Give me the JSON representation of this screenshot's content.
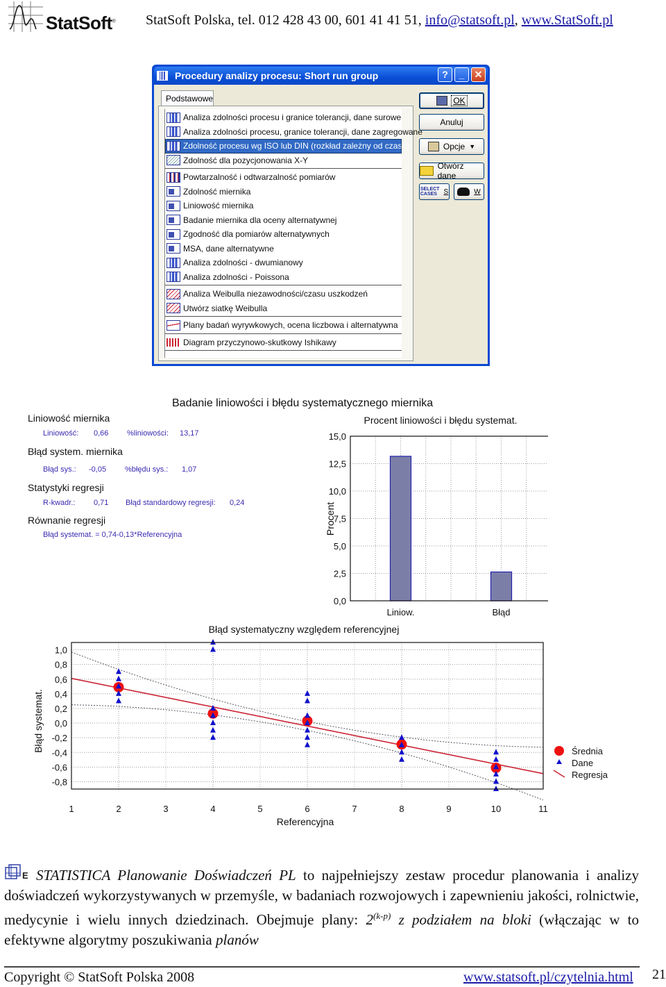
{
  "header": {
    "brand": "StatSoft",
    "contact_prefix": "StatSoft Polska, tel. 012 428 43 00, 601 41 41 51, ",
    "email": "info@statsoft.pl",
    "separator": ", ",
    "website": "www.StatSoft.pl"
  },
  "dialog": {
    "title": "Procedury analizy procesu: Short run group",
    "title_buttons": {
      "help": "?",
      "minimize": "_",
      "close": "✕"
    },
    "tab": "Podstawowe",
    "list_groups": [
      [
        {
          "label": "Analiza zdolności procesu i granice tolerancji, dane surowe",
          "icon": "capability-icon"
        },
        {
          "label": "Analiza zdolności procesu, granice tolerancji, dane zagregowane",
          "icon": "capability-icon"
        },
        {
          "label": "Zdolność procesu wg ISO lub DIN (rozkład zależny od czasu)",
          "icon": "capability-icon",
          "selected": true
        },
        {
          "label": "Zdolność dla pozycjonowania X-Y",
          "icon": "xy-scatter-icon"
        }
      ],
      [
        {
          "label": "Powtarzalność i odtwarzalność pomiarów",
          "icon": "rr-icon"
        },
        {
          "label": "Zdolność miernika",
          "icon": "gage-icon"
        },
        {
          "label": "Liniowość miernika",
          "icon": "gage-icon"
        },
        {
          "label": "Badanie miernika dla oceny alternatywnej",
          "icon": "gage-icon"
        },
        {
          "label": "Zgodność dla pomiarów alternatywnych",
          "icon": "gage-icon"
        },
        {
          "label": "MSA, dane alternatywne",
          "icon": "gage-icon"
        },
        {
          "label": "Analiza zdolności - dwumianowy",
          "icon": "capability-icon"
        },
        {
          "label": "Analiza zdolności - Poissona",
          "icon": "capability-icon"
        }
      ],
      [
        {
          "label": "Analiza Weibulla niezawodności/czasu uszkodzeń",
          "icon": "weibull-icon"
        },
        {
          "label": "Utwórz siatkę Weibulla",
          "icon": "weibull-icon"
        }
      ],
      [
        {
          "label": "Plany badań wyrywkowych, ocena liczbowa i alternatywna",
          "icon": "sampling-icon"
        }
      ],
      [
        {
          "label": "Diagram przyczynowo-skutkowy Ishikawy",
          "icon": "ishikawa-icon"
        }
      ]
    ],
    "buttons": {
      "ok": "OK",
      "cancel": "Anuluj",
      "options": "Opcje",
      "open_data": "Otwórz dane",
      "select_cases_line1": "SELECT",
      "select_cases_line2": "CASES",
      "select_cases_key": "S",
      "print_key": "W"
    }
  },
  "figure": {
    "title": "Badanie liniowości i błędu systematycznego miernika",
    "stats": {
      "linearity_heading": "Liniowość miernika",
      "linearity_label": "Liniowość:",
      "linearity_value": "0,66",
      "pct_linearity_label": "%liniowości:",
      "pct_linearity_value": "13,17",
      "bias_heading": "Błąd system. miernika",
      "bias_label": "Błąd sys.:",
      "bias_value": "-0,05",
      "pct_bias_label": "%błędu sys.:",
      "pct_bias_value": "1,07",
      "regression_heading": "Statystyki regresji",
      "r2_label": "R-kwadr.:",
      "r2_value": "0,71",
      "se_label": "Błąd standardowy regresji:",
      "se_value": "0,24",
      "equation_heading": "Równanie regresji",
      "equation": "Błąd systemat. = 0,74-0,13*Referencyjna"
    }
  },
  "chart_data": [
    {
      "type": "bar",
      "title": "Procent liniowości i błędu systemat.",
      "xlabel": "",
      "ylabel": "Procent",
      "categories": [
        "Liniow.",
        "Błąd"
      ],
      "values": [
        13.17,
        2.63
      ],
      "ylim": [
        0,
        15
      ],
      "yticks": [
        "0,0",
        "2,5",
        "5,0",
        "7,5",
        "10,0",
        "12,5",
        "15,0"
      ],
      "grid": true,
      "bar_color": "#7b7fa8",
      "bar_edge": "#2222aa"
    },
    {
      "type": "scatter",
      "title": "Błąd systematyczny względem referencyjnej",
      "xlabel": "Referencyjna",
      "ylabel": "Błąd systemat.",
      "xlim": [
        1,
        11
      ],
      "ylim": [
        -0.9,
        1.1
      ],
      "xticks": [
        "1",
        "2",
        "3",
        "4",
        "5",
        "6",
        "7",
        "8",
        "9",
        "10",
        "11"
      ],
      "yticks": [
        "1,0",
        "0,8",
        "0,6",
        "0,4",
        "0,2",
        "0,0",
        "-0,2",
        "-0,4",
        "-0,6",
        "-0,8"
      ],
      "ytick_values": [
        1.0,
        0.8,
        0.6,
        0.4,
        0.2,
        0.0,
        -0.2,
        -0.4,
        -0.6,
        -0.8
      ],
      "grid": true,
      "legend_position": "right",
      "series": [
        {
          "name": "Średnia",
          "marker": "circle",
          "color": "#ee1111",
          "points": [
            [
              2,
              0.49
            ],
            [
              4,
              0.13
            ],
            [
              6,
              0.03
            ],
            [
              8,
              -0.29
            ],
            [
              10,
              -0.61
            ]
          ]
        },
        {
          "name": "Dane",
          "marker": "triangle",
          "color": "#1111cc",
          "points": [
            [
              2,
              0.7
            ],
            [
              2,
              0.6
            ],
            [
              2,
              0.5
            ],
            [
              2,
              0.4
            ],
            [
              2,
              0.3
            ],
            [
              4,
              1.1
            ],
            [
              4,
              1.0
            ],
            [
              4,
              0.2
            ],
            [
              4,
              0.1
            ],
            [
              4,
              0.0
            ],
            [
              4,
              -0.1
            ],
            [
              4,
              -0.2
            ],
            [
              6,
              0.4
            ],
            [
              6,
              0.3
            ],
            [
              6,
              0.1
            ],
            [
              6,
              0.0
            ],
            [
              6,
              -0.1
            ],
            [
              6,
              -0.2
            ],
            [
              6,
              -0.3
            ],
            [
              8,
              -0.2
            ],
            [
              8,
              -0.3
            ],
            [
              8,
              -0.4
            ],
            [
              8,
              -0.5
            ],
            [
              10,
              -0.4
            ],
            [
              10,
              -0.5
            ],
            [
              10,
              -0.6
            ],
            [
              10,
              -0.7
            ],
            [
              10,
              -0.8
            ],
            [
              10,
              -0.9
            ]
          ]
        },
        {
          "name": "Regresja",
          "type": "line",
          "color": "#cc2233",
          "intercept": 0.74,
          "slope": -0.13,
          "confidence_band": true
        }
      ]
    }
  ],
  "body": {
    "product_italic": "STATISTICA Planowanie Doświadczeń PL",
    "text_1": " to najpełniejszy zestaw procedur planowania i analizy doświadczeń wykorzystywanych w przemyśle, w badaniach rozwojowych i zapewnieniu jakości, rolnictwie, medycynie i wielu innych dziedzinach. Obejmuje plany: ",
    "formula_base": "2",
    "formula_exp": "(k-p)",
    "text_italic_2": " z podziałem na bloki",
    "text_3": " (włączając w to efektywne algorytmy poszukiwania ",
    "text_italic_3": "planów"
  },
  "footer": {
    "copyright": "Copyright © StatSoft Polska 2008",
    "link": "www.statsoft.pl/czytelnia.html",
    "page": "21"
  }
}
